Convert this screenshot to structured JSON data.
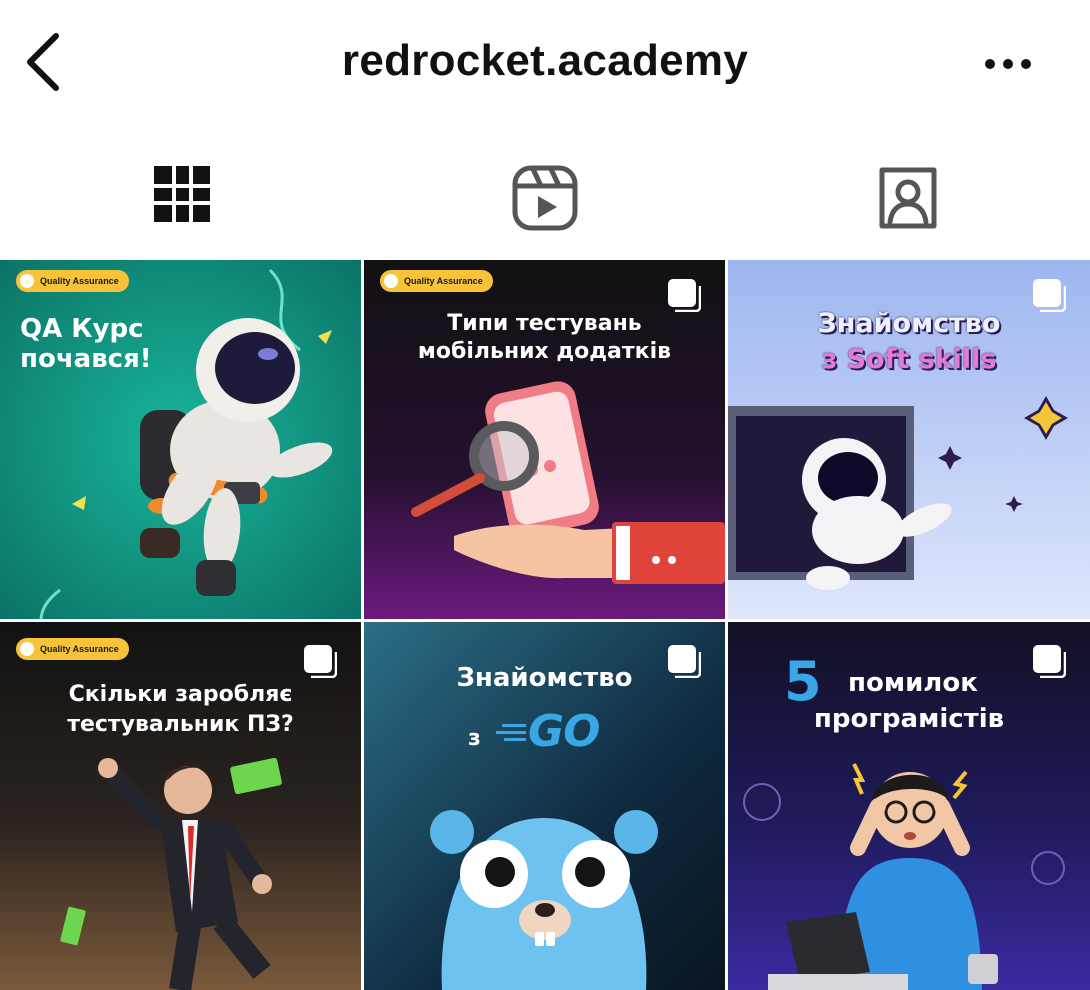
{
  "header": {
    "username": "redrocket.academy",
    "back_icon": "chevron-left-icon",
    "more_icon": "more-horizontal-icon"
  },
  "tabs": [
    {
      "name": "posts",
      "icon": "grid-icon",
      "active": true
    },
    {
      "name": "reels",
      "icon": "reels-icon",
      "active": false
    },
    {
      "name": "tagged",
      "icon": "tagged-user-icon",
      "active": false
    }
  ],
  "posts": [
    {
      "title_lines": [
        "QA Курс",
        "почався!"
      ],
      "badge": "Quality Assurance"
    },
    {
      "title_lines": [
        "Типи тестувань",
        "мобільних додатків"
      ],
      "badge": "Quality Assurance"
    },
    {
      "title_lines": [
        "Знайомство",
        "з Soft skills"
      ]
    },
    {
      "title_lines": [
        "Скільки заробляє",
        "тестувальник ПЗ?"
      ],
      "badge": "Quality Assurance"
    },
    {
      "title_lines": [
        "Знайомство",
        "з",
        "GO"
      ]
    },
    {
      "title_lines": [
        "5",
        "помилок",
        "програмістів"
      ]
    }
  ],
  "colors": {
    "accent_green": "#12a08a",
    "badge_yellow": "#f6c33a",
    "soft_skills_pink": "#e27ad6",
    "go_blue": "#39a7e6"
  }
}
